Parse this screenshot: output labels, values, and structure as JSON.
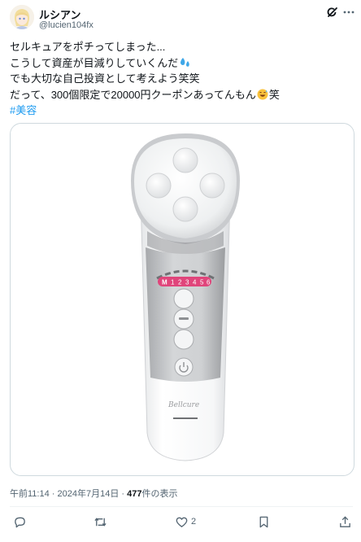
{
  "author": {
    "display_name": "ルシアン",
    "handle": "@lucien104fx"
  },
  "tweet": {
    "lines": [
      "セルキュアをポチってしまった...",
      "こうして資産が目減りしていくんだ",
      "でも大切な自己投資として考えよう笑笑",
      "だって、300個限定で20000円クーポンあってんもん",
      "笑"
    ],
    "hashtag": "#美容"
  },
  "media": {
    "device_mode_numbers": [
      "1",
      "2",
      "3",
      "4",
      "5",
      "6"
    ],
    "device_mode_letter": "M",
    "device_brand": "Bellcure"
  },
  "meta": {
    "time": "午前11:14",
    "date": "2024年7月14日",
    "views": "477",
    "views_suffix": "件の表示",
    "separator": "·"
  },
  "actions": {
    "like_count": "2"
  },
  "icons": {
    "grok": "grok-icon",
    "more": "more-icon",
    "reply": "reply-icon",
    "retweet": "retweet-icon",
    "like": "like-icon",
    "bookmark": "bookmark-icon",
    "share": "share-icon",
    "emoji_sweat": "sweat-droplets-emoji",
    "emoji_laugh": "grinning-sweat-emoji"
  },
  "colors": {
    "link": "#1d9bf0",
    "secondary_text": "#536471",
    "device_accent": "#e0457b"
  }
}
